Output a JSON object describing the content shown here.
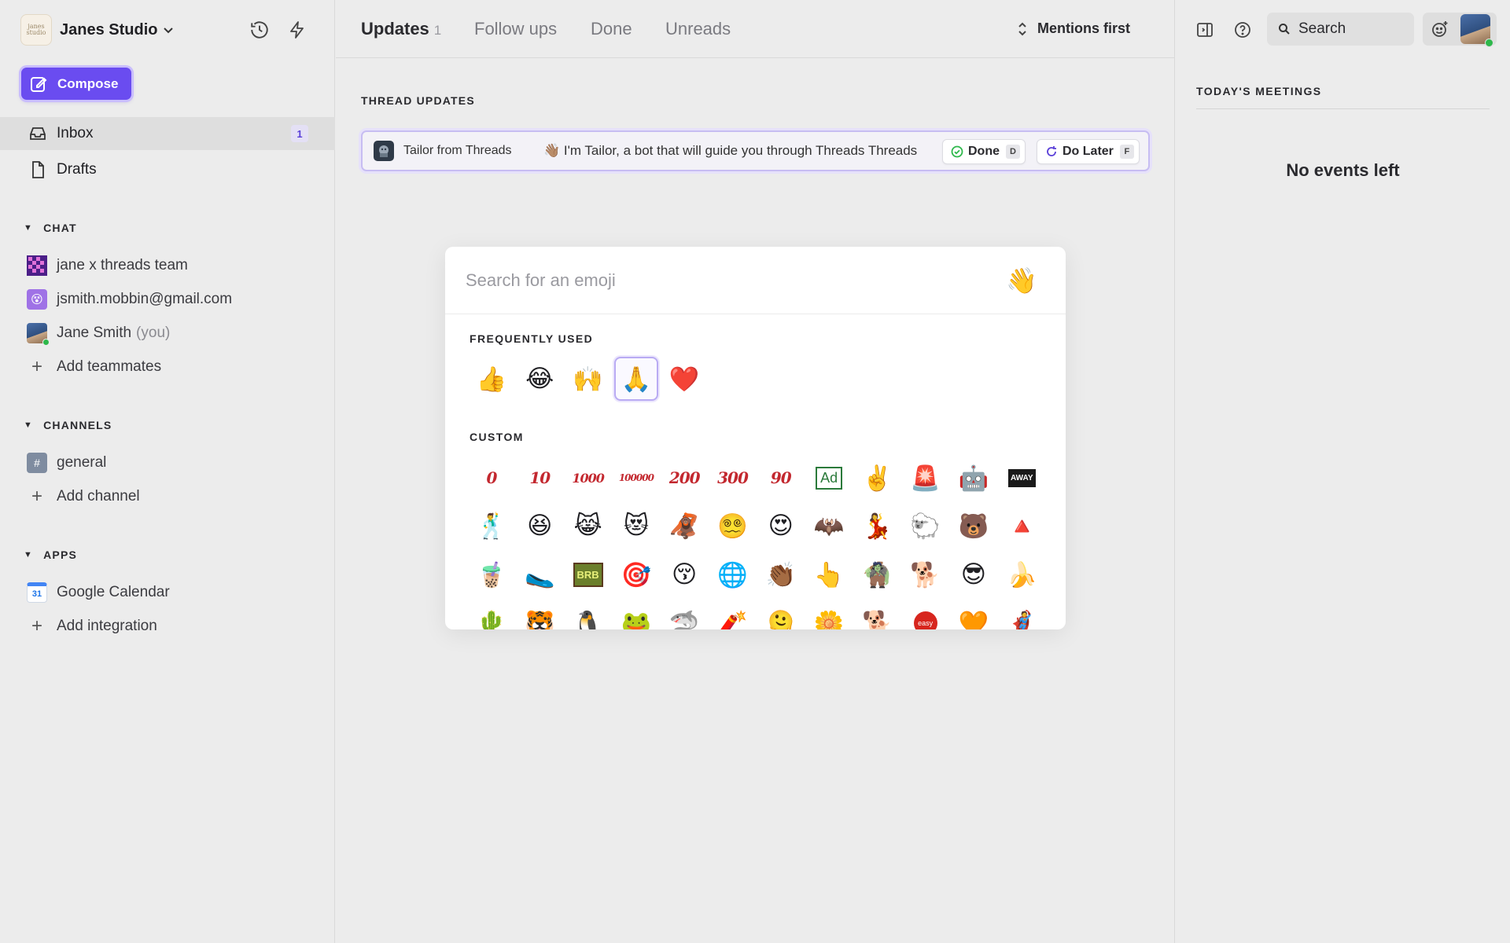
{
  "workspace": {
    "name": "Janes Studio",
    "logo_text": "janes studio"
  },
  "compose": {
    "label": "Compose"
  },
  "nav": [
    {
      "label": "Inbox",
      "badge": "1"
    },
    {
      "label": "Drafts"
    }
  ],
  "chat": {
    "title": "CHAT",
    "items": [
      {
        "label": "jane x threads team",
        "suffix": ""
      },
      {
        "label": "jsmith.mobbin@gmail.com",
        "suffix": ""
      },
      {
        "label": "Jane Smith",
        "suffix": "(you)"
      }
    ],
    "add_label": "Add teammates"
  },
  "channels": {
    "title": "CHANNELS",
    "items": [
      {
        "label": "general"
      }
    ],
    "add_label": "Add channel"
  },
  "apps": {
    "title": "APPS",
    "items": [
      {
        "label": "Google Calendar",
        "icon_text": "31"
      }
    ],
    "add_label": "Add integration"
  },
  "tabs": [
    {
      "label": "Updates",
      "count": "1"
    },
    {
      "label": "Follow ups"
    },
    {
      "label": "Done"
    },
    {
      "label": "Unreads"
    }
  ],
  "sort": {
    "label": "Mentions first"
  },
  "thread_updates": {
    "title": "THREAD UPDATES",
    "from": "Tailor from Threads",
    "message": "👋🏽 I'm Tailor, a bot that will guide you through Threads Threads",
    "done_label": "Done",
    "done_key": "D",
    "later_label": "Do Later",
    "later_key": "F"
  },
  "emoji_picker": {
    "placeholder": "Search for an emoji",
    "skin_tone": "👋",
    "frequent_title": "FREQUENTLY USED",
    "frequent": [
      "👍",
      "😂",
      "🙌",
      "🙏",
      "❤️"
    ],
    "custom_title": "CUSTOM",
    "custom_row1_text": [
      "0",
      "10",
      "1000",
      "100000",
      "200",
      "300",
      "90"
    ],
    "custom_ad": "Ad",
    "custom_away": "AWAY",
    "custom_brb": "BRB",
    "custom_easy": "easy",
    "custom_row1_icons": [
      "✌️",
      "🚨",
      "🤖"
    ],
    "custom_row2": [
      "🕺",
      "😆",
      "😹",
      "😻",
      "🦧",
      "😵‍💫",
      "😍",
      "🦇",
      "💃",
      "🐑",
      "🐻",
      "🔺"
    ],
    "custom_row3": [
      "🧋",
      "🥿",
      "🎯",
      "😚",
      "🌐",
      "👏🏾",
      "👆",
      "🧌",
      "🐕",
      "😎",
      "🍌"
    ],
    "custom_row4": [
      "🌵",
      "🐯",
      "🐧",
      "🐸",
      "🦈",
      "🧨",
      "🫠",
      "🌼",
      "🐕",
      "🧡",
      "🦸"
    ]
  },
  "right_panel": {
    "search_label": "Search",
    "meetings_title": "TODAY'S MEETINGS",
    "no_events": "No events left"
  }
}
